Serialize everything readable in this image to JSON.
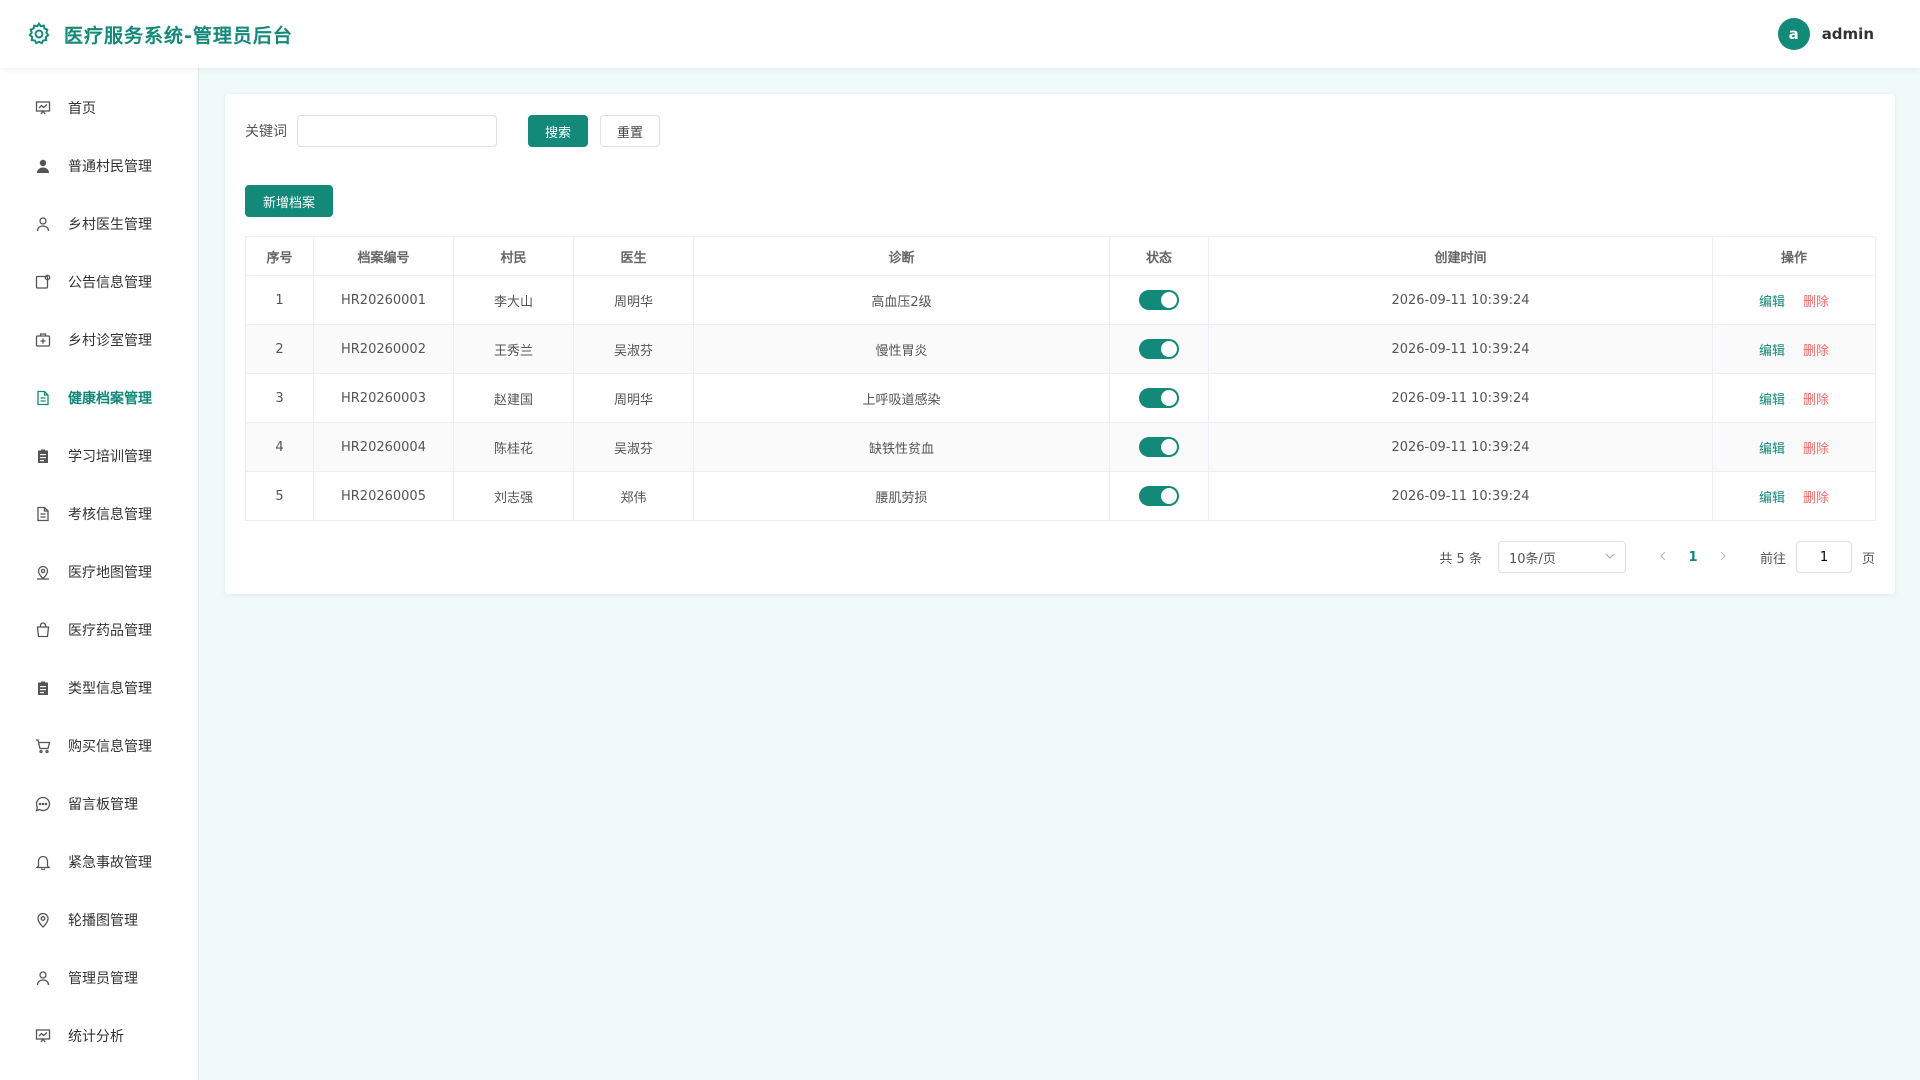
{
  "header": {
    "title": "医疗服务系统-管理员后台",
    "avatar_letter": "a",
    "username": "admin",
    "accent_color": "#13897a"
  },
  "sidebar": {
    "items": [
      {
        "label": "首页",
        "icon": "dashboard-icon"
      },
      {
        "label": "普通村民管理",
        "icon": "user-filled-icon"
      },
      {
        "label": "乡村医生管理",
        "icon": "user-icon"
      },
      {
        "label": "公告信息管理",
        "icon": "notice-icon"
      },
      {
        "label": "乡村诊室管理",
        "icon": "clinic-icon"
      },
      {
        "label": "健康档案管理",
        "icon": "document-icon",
        "active": true
      },
      {
        "label": "学习培训管理",
        "icon": "clipboard-icon"
      },
      {
        "label": "考核信息管理",
        "icon": "document-icon"
      },
      {
        "label": "医疗地图管理",
        "icon": "map-icon"
      },
      {
        "label": "医疗药品管理",
        "icon": "bag-icon"
      },
      {
        "label": "类型信息管理",
        "icon": "clipboard-icon"
      },
      {
        "label": "购买信息管理",
        "icon": "cart-icon"
      },
      {
        "label": "留言板管理",
        "icon": "chat-icon"
      },
      {
        "label": "紧急事故管理",
        "icon": "bell-icon"
      },
      {
        "label": "轮播图管理",
        "icon": "location-icon"
      },
      {
        "label": "管理员管理",
        "icon": "user-icon"
      },
      {
        "label": "统计分析",
        "icon": "chart-icon"
      }
    ]
  },
  "search": {
    "label": "关键词",
    "value": "",
    "placeholder": "",
    "search_button": "搜索",
    "reset_button": "重置"
  },
  "actions": {
    "add_button": "新增档案"
  },
  "table": {
    "columns": [
      "序号",
      "档案编号",
      "村民",
      "医生",
      "诊断",
      "状态",
      "创建时间",
      "操作"
    ],
    "rows": [
      {
        "index": "1",
        "code": "HR20260001",
        "villager": "李大山",
        "doctor": "周明华",
        "diagnosis": "高血压2级",
        "status": true,
        "created": "2026-09-11 10:39:24"
      },
      {
        "index": "2",
        "code": "HR20260002",
        "villager": "王秀兰",
        "doctor": "吴淑芬",
        "diagnosis": "慢性胃炎",
        "status": true,
        "created": "2026-09-11 10:39:24"
      },
      {
        "index": "3",
        "code": "HR20260003",
        "villager": "赵建国",
        "doctor": "周明华",
        "diagnosis": "上呼吸道感染",
        "status": true,
        "created": "2026-09-11 10:39:24"
      },
      {
        "index": "4",
        "code": "HR20260004",
        "villager": "陈桂花",
        "doctor": "吴淑芬",
        "diagnosis": "缺铁性贫血",
        "status": true,
        "created": "2026-09-11 10:39:24"
      },
      {
        "index": "5",
        "code": "HR20260005",
        "villager": "刘志强",
        "doctor": "郑伟",
        "diagnosis": "腰肌劳损",
        "status": true,
        "created": "2026-09-11 10:39:24"
      }
    ],
    "edit_label": "编辑",
    "delete_label": "删除"
  },
  "pagination": {
    "total_text": "共 5 条",
    "page_size": "10条/页",
    "current_page": "1",
    "goto_label": "前往",
    "goto_value": "1",
    "page_unit": "页"
  }
}
